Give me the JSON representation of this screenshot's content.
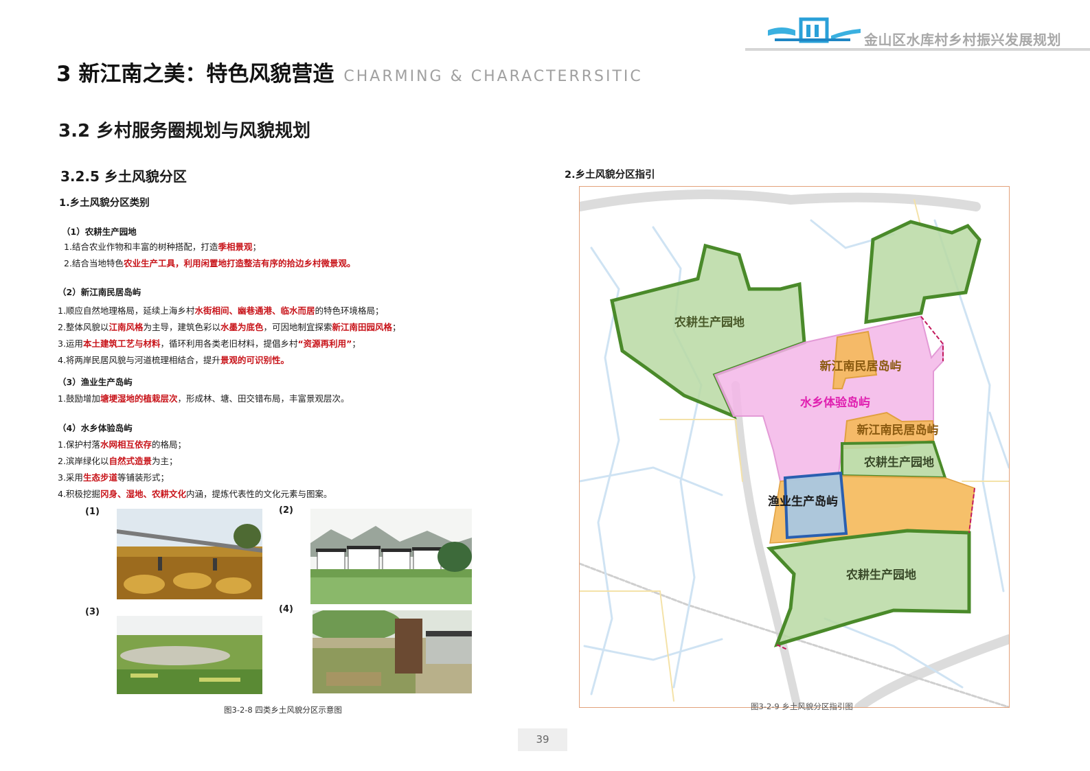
{
  "header": {
    "doc_title": "金山区水库村乡村振兴发展规划",
    "logo_icon": "village-logo-icon"
  },
  "page_title": {
    "cn": "3 新江南之美：特色风貌营造",
    "en": "CHARMING & CHARACTERRSITIC"
  },
  "section": "3.2 乡村服务圈规划与风貌规划",
  "subsection": "3.2.5 乡土风貌分区",
  "left": {
    "heading1": "1.乡土风貌分区类别",
    "groups": [
      {
        "title": "（1）农耕生产园地",
        "lines": [
          [
            {
              "t": "1.结合农业作物和丰富的树种搭配，打造"
            },
            {
              "t": "季相景观",
              "r": true
            },
            {
              "t": "；"
            }
          ],
          [
            {
              "t": "2.结合当地特色"
            },
            {
              "t": "农业生产工具，利用闲置地打造整洁有序的拾边乡村微景观。",
              "r": true
            }
          ]
        ]
      },
      {
        "title": "（2）新江南民居岛屿",
        "lines": [
          [
            {
              "t": "1.顺应自然地理格局，延续上海乡村"
            },
            {
              "t": "水街相间、幽巷通港、临水而居",
              "r": true
            },
            {
              "t": "的特色环境格局；"
            }
          ],
          [
            {
              "t": "2.整体风貌以"
            },
            {
              "t": "江南风格",
              "r": true
            },
            {
              "t": "为主导，建筑色彩以"
            },
            {
              "t": "水墨为底色",
              "r": true
            },
            {
              "t": "，可因地制宜探索"
            },
            {
              "t": "新江南田园风格",
              "r": true
            },
            {
              "t": "；"
            }
          ],
          [
            {
              "t": "3.运用"
            },
            {
              "t": "本土建筑工艺与材料",
              "r": true
            },
            {
              "t": "，循环利用各类老旧材料，提倡乡村"
            },
            {
              "t": "“资源再利用”",
              "r": true
            },
            {
              "t": "；"
            }
          ],
          [
            {
              "t": "4.将两岸民居风貌与河道梳理相结合，提升"
            },
            {
              "t": "景观的可识别性。",
              "r": true
            }
          ]
        ]
      },
      {
        "title": "（3）渔业生产岛屿",
        "lines": [
          [
            {
              "t": "1.鼓励增加"
            },
            {
              "t": "塘埂湿地的植栽层次",
              "r": true
            },
            {
              "t": "，形成林、塘、田交错布局，丰富景观层次。"
            }
          ]
        ]
      },
      {
        "title": "（4）水乡体验岛屿",
        "lines": [
          [
            {
              "t": "1.保护村落"
            },
            {
              "t": "水网相互依存",
              "r": true
            },
            {
              "t": "的格局；"
            }
          ],
          [
            {
              "t": "2.滨岸绿化以"
            },
            {
              "t": "自然式造景",
              "r": true
            },
            {
              "t": "为主；"
            }
          ],
          [
            {
              "t": "3.采用"
            },
            {
              "t": "生态步道",
              "r": true
            },
            {
              "t": "等铺装形式；"
            }
          ],
          [
            {
              "t": "4.积极挖掘"
            },
            {
              "t": "冈身、湿地、农耕文化",
              "r": true
            },
            {
              "t": "内涵，提炼代表性的文化元素与图案。"
            }
          ]
        ]
      }
    ],
    "photo_labels": [
      "(1)",
      "(2)",
      "(3)",
      "(4)"
    ],
    "photo_caption": "图3-2-8 四类乡土风貌分区示意图"
  },
  "right": {
    "heading": "2.乡土风貌分区指引",
    "zones": {
      "farm_nw": "农耕生产园地",
      "res_n": "新江南民居岛屿",
      "water": "水乡体验岛屿",
      "res_e": "新江南民居岛屿",
      "farm_e": "农耕生产园地",
      "fish": "渔业生产岛屿",
      "farm_s": "农耕生产园地"
    },
    "caption": "图3-2-9 乡土风貌分区指引图"
  },
  "page_number": "39",
  "colors": {
    "red_emphasis": "#c8141a",
    "farm_fill": "#b9d9a3",
    "farm_stroke": "#4a8a2a",
    "residential_fill": "#f5b95a",
    "water_fill": "#f3b6e8",
    "water_label": "#e020b0",
    "fishery_fill": "#a9c7e2",
    "fishery_stroke": "#2a5fb0",
    "header_gray": "#a8a8a8"
  }
}
